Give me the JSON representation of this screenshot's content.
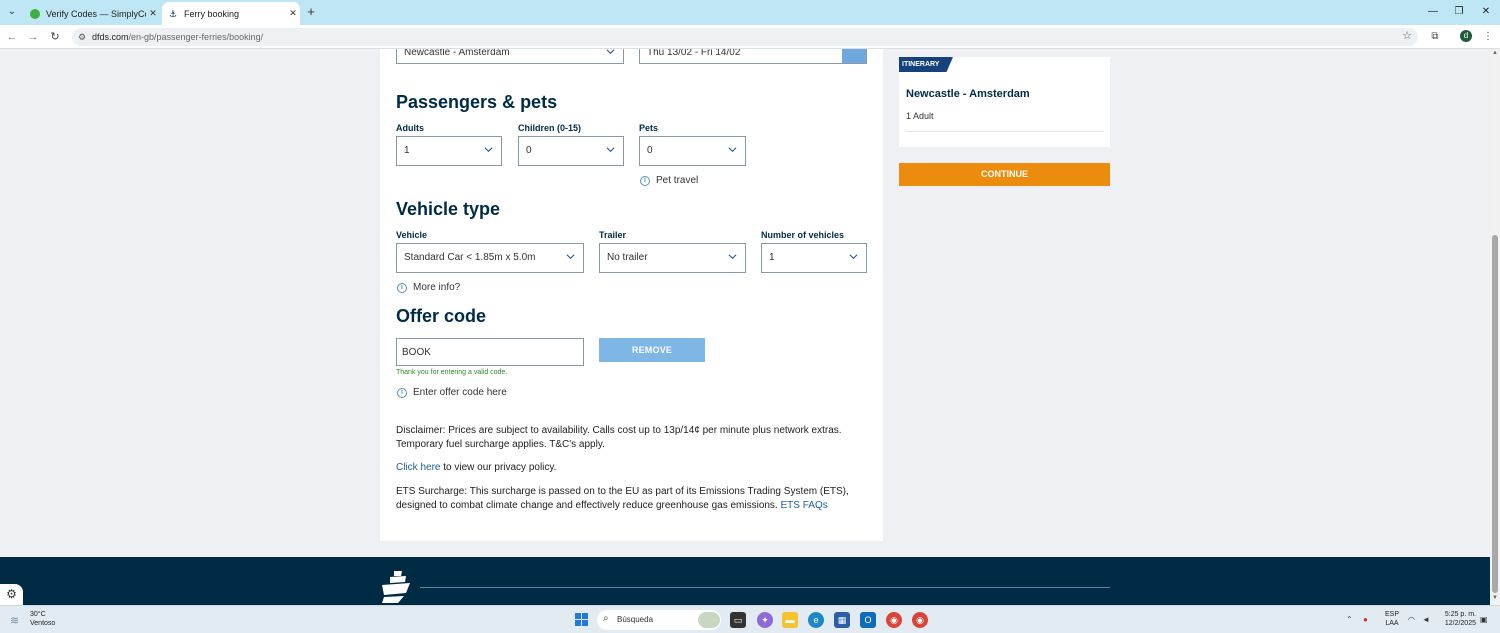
{
  "browser": {
    "tabs": [
      {
        "title": "Verify Codes — SimplyCodes",
        "active": false
      },
      {
        "title": "Ferry booking",
        "active": true
      }
    ],
    "new_tab": "+",
    "url_host": "dfds.com",
    "url_path": "/en-gb/passenger-ferries/booking/",
    "profile_initial": "d"
  },
  "route_select": {
    "value": "Newcastle - Amsterdam"
  },
  "date_select": {
    "value": "Thu 13/02 - Fri 14/02"
  },
  "passengers": {
    "title": "Passengers & pets",
    "adults": {
      "label": "Adults",
      "value": "1"
    },
    "children": {
      "label": "Children (0-15)",
      "value": "0"
    },
    "pets": {
      "label": "Pets",
      "value": "0"
    },
    "pet_info": "Pet travel"
  },
  "vehicle": {
    "title": "Vehicle type",
    "vehicle": {
      "label": "Vehicle",
      "value": "Standard Car < 1.85m x 5.0m"
    },
    "trailer": {
      "label": "Trailer",
      "value": "No trailer"
    },
    "count": {
      "label": "Number of vehicles",
      "value": "1"
    },
    "more_info": "More info?"
  },
  "offer": {
    "title": "Offer code",
    "code": "BOOK",
    "remove_label": "REMOVE",
    "valid_message": "Thank you for entering a valid code.",
    "hint": "Enter offer code here"
  },
  "legal": {
    "disclaimer": "Disclaimer: Prices are subject to availability. Calls cost up to 13p/14¢ per minute plus network extras. Temporary fuel surcharge applies. T&C's apply.",
    "privacy_link": "Click here",
    "privacy_rest": " to view our privacy policy.",
    "ets_text": "ETS Surcharge: This surcharge is passed on to the EU as part of its Emissions Trading System (ETS), designed to combat climate change and effectively reduce greenhouse gas emissions. ",
    "ets_link": "ETS FAQs"
  },
  "itinerary": {
    "badge": "ITINERARY",
    "route": "Newcastle - Amsterdam",
    "passengers": "1 Adult",
    "continue_label": "CONTINUE"
  },
  "taskbar": {
    "temp": "30°C",
    "weather": "Ventoso",
    "search_placeholder": "Búsqueda",
    "lang_1": "ESP",
    "lang_2": "LAA",
    "time": "5:25 p. m.",
    "date": "12/2/2025"
  },
  "colors": {
    "brand_navy": "#002b45",
    "continue_orange": "#ec8c0e",
    "remove_blue": "#7eb6e6",
    "valid_green": "#2e8b2e"
  }
}
